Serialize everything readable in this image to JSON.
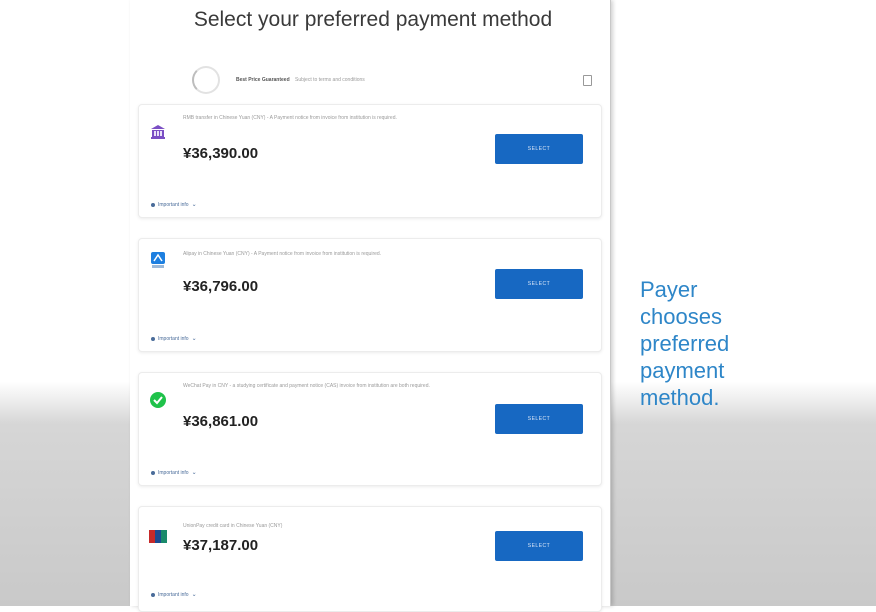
{
  "page": {
    "title": "Select your preferred payment method"
  },
  "banner": {
    "headline": "Best Price Guaranteed",
    "subtext": "Subject to terms and conditions"
  },
  "methods": [
    {
      "icon": "bank-icon",
      "description": "RMB transfer in Chinese Yuan (CNY) - A Payment notice from invoice from institution is required.",
      "price": "¥36,390.00",
      "select_label": "SELECT",
      "info_label": "Important info"
    },
    {
      "icon": "alipay-icon",
      "description": "Alipay in Chinese Yuan (CNY) - A Payment notice from invoice from institution is required.",
      "price": "¥36,796.00",
      "select_label": "SELECT",
      "info_label": "Important info"
    },
    {
      "icon": "wechat-pay-icon",
      "description": "WeChat Pay in CNY - a studying certificate and payment notice (CAS) invoice from institution are both required.",
      "price": "¥36,861.00",
      "select_label": "SELECT",
      "info_label": "Important info"
    },
    {
      "icon": "unionpay-card-icon",
      "description": "UnionPay credit card in Chinese Yuan (CNY)",
      "price": "¥37,187.00",
      "select_label": "SELECT",
      "info_label": "Important info"
    }
  ],
  "caption": {
    "lines": [
      "Payer",
      "chooses",
      "preferred",
      "payment",
      "method."
    ]
  },
  "colors": {
    "button": "#1768c2",
    "caption": "#2e86c8",
    "bank_icon": "#7b4fc4",
    "alipay_icon": "#1d7fe0",
    "wechat_icon": "#1fc24a",
    "unionpay_icon": "#c62a2a"
  }
}
